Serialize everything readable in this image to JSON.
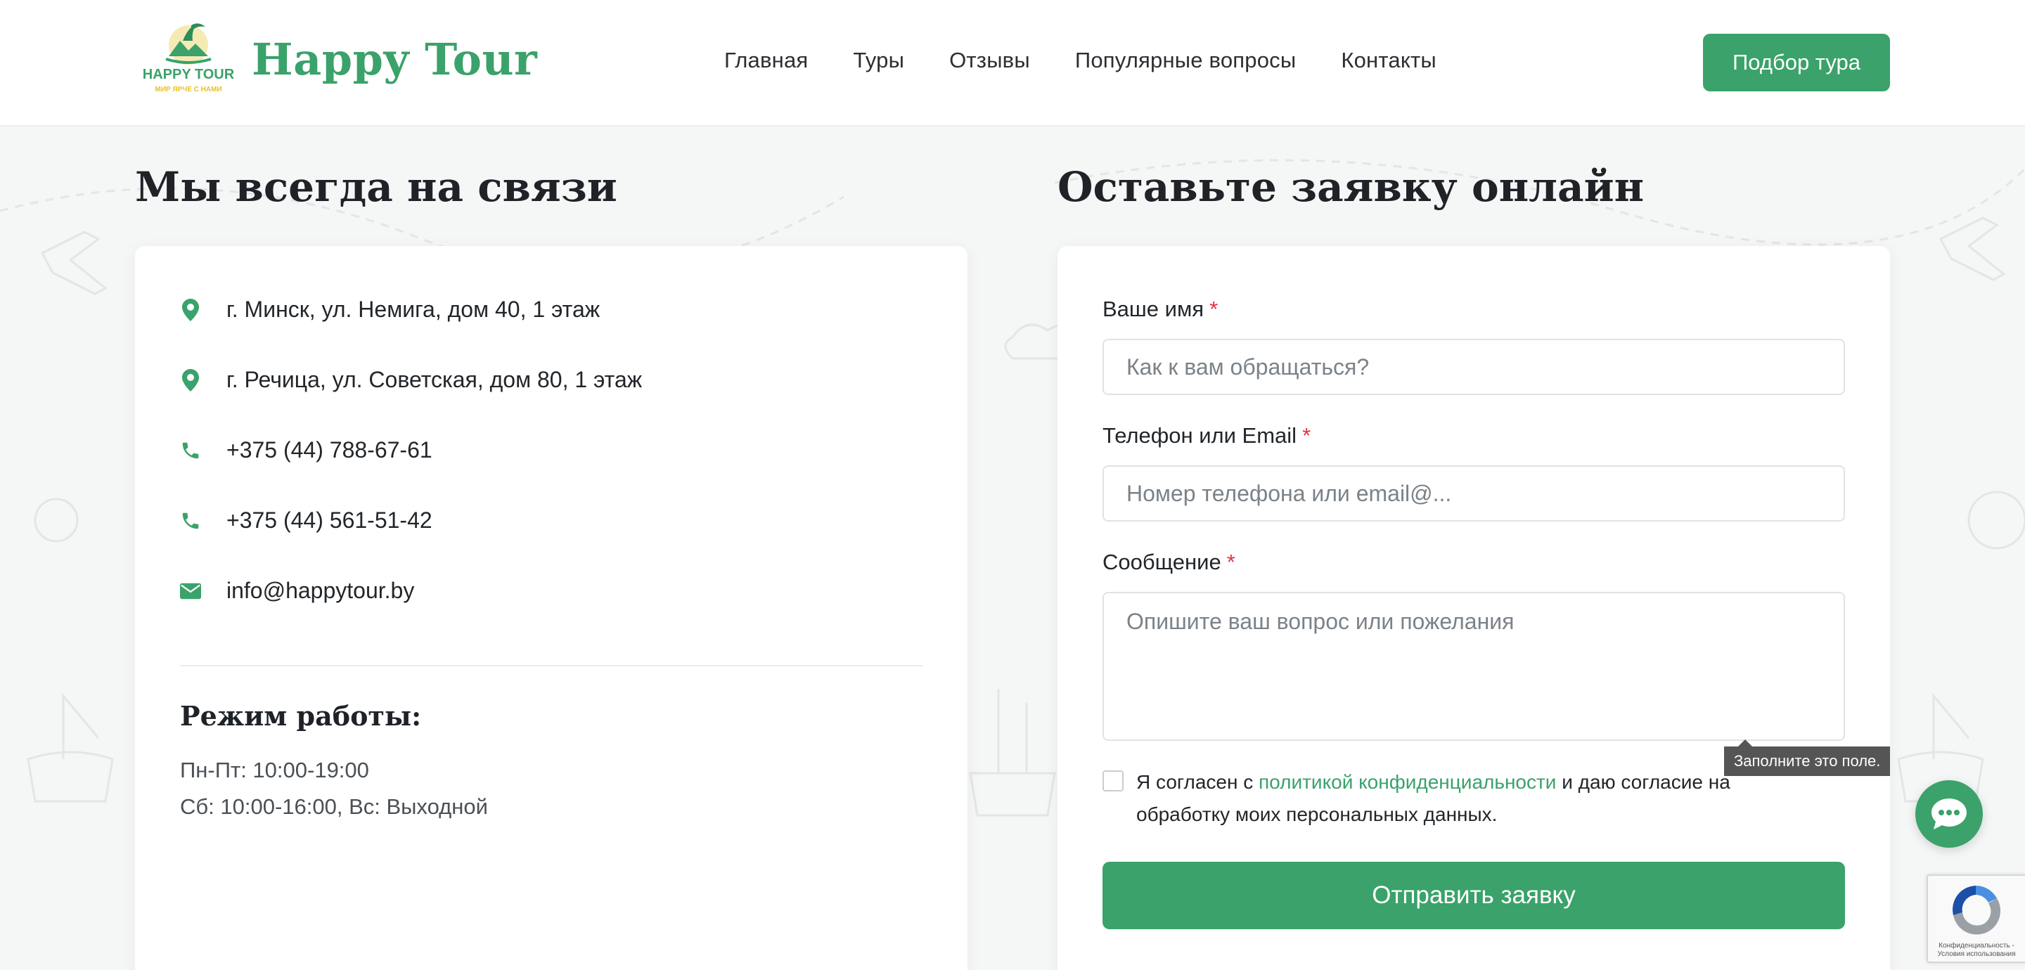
{
  "header": {
    "logo_top": "HAPPY TOUR",
    "logo_sub": "МИР ЯРЧЕ С НАМИ",
    "brand": "Happy Tour",
    "nav": [
      "Главная",
      "Туры",
      "Отзывы",
      "Популярные вопросы",
      "Контакты"
    ],
    "cta": "Подбор тура"
  },
  "contacts": {
    "heading": "Мы всегда на связи",
    "items": [
      {
        "icon": "map-pin-icon",
        "text": "г. Минск, ул. Немига, дом 40, 1 этаж"
      },
      {
        "icon": "map-pin-icon",
        "text": "г. Речица, ул. Советская, дом 80, 1 этаж"
      },
      {
        "icon": "phone-icon",
        "text": "+375 (44) 788-67-61"
      },
      {
        "icon": "phone-icon",
        "text": "+375 (44) 561-51-42"
      },
      {
        "icon": "envelope-icon",
        "text": "info@happytour.by"
      }
    ],
    "hours_title": "Режим работы:",
    "hours": [
      "Пн-Пт: 10:00-19:00",
      "Сб: 10:00-16:00, Вс: Выходной"
    ]
  },
  "form": {
    "heading": "Оставьте заявку онлайн",
    "name_label": "Ваше имя",
    "name_placeholder": "Как к вам обращаться?",
    "contact_label": "Телефон или Email",
    "contact_placeholder": "Номер телефона или email@...",
    "message_label": "Сообщение",
    "message_placeholder": "Опишите ваш вопрос или пожелания",
    "required_mark": "*",
    "consent_pre": "Я согласен с ",
    "consent_link": "политикой конфиденциальности",
    "consent_post": " и даю согласие на обработку моих персональных данных.",
    "submit": "Отправить заявку",
    "tooltip": "Заполните это поле."
  },
  "recaptcha": {
    "text": "Конфиденциальность - Условия использования"
  },
  "colors": {
    "accent": "#3aa26a",
    "required": "#dc3545",
    "logo_yellow": "#e6c229"
  }
}
